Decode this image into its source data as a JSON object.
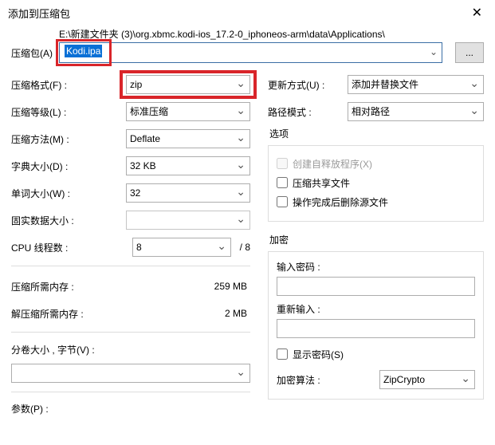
{
  "window": {
    "title": "添加到压缩包"
  },
  "archive": {
    "path_display": "E:\\新建文件夹 (3)\\org.xbmc.kodi-ios_17.2-0_iphoneos-arm\\data\\Applications\\",
    "label": "压缩包(A)",
    "filename": "Kodi.ipa",
    "browse": "..."
  },
  "left": {
    "format_label": "压缩格式(F) :",
    "format_value": "zip",
    "level_label": "压缩等级(L) :",
    "level_value": "标准压缩",
    "method_label": "压缩方法(M) :",
    "method_value": "Deflate",
    "dict_label": "字典大小(D) :",
    "dict_value": "32 KB",
    "word_label": "单词大小(W) :",
    "word_value": "32",
    "solid_label": "固实数据大小 :",
    "solid_value": "",
    "cpu_label": "CPU 线程数 :",
    "cpu_value": "8",
    "cpu_total": "/ 8",
    "mem_comp_label": "压缩所需内存 :",
    "mem_comp_value": "259 MB",
    "mem_decomp_label": "解压缩所需内存 :",
    "mem_decomp_value": "2 MB",
    "split_label": "分卷大小 , 字节(V) :",
    "split_value": "",
    "params_label": "参数(P) :"
  },
  "right": {
    "update_label": "更新方式(U) :",
    "update_value": "添加并替换文件",
    "pathmode_label": "路径模式 :",
    "pathmode_value": "相对路径",
    "options_title": "选项",
    "opt_sfx": "创建自释放程序(X)",
    "opt_share": "压缩共享文件",
    "opt_delete": "操作完成后删除源文件",
    "enc_title": "加密",
    "enc_pw_label": "输入密码 :",
    "enc_pw2_label": "重新输入 :",
    "enc_show": "显示密码(S)",
    "enc_alg_label": "加密算法 :",
    "enc_alg_value": "ZipCrypto"
  }
}
